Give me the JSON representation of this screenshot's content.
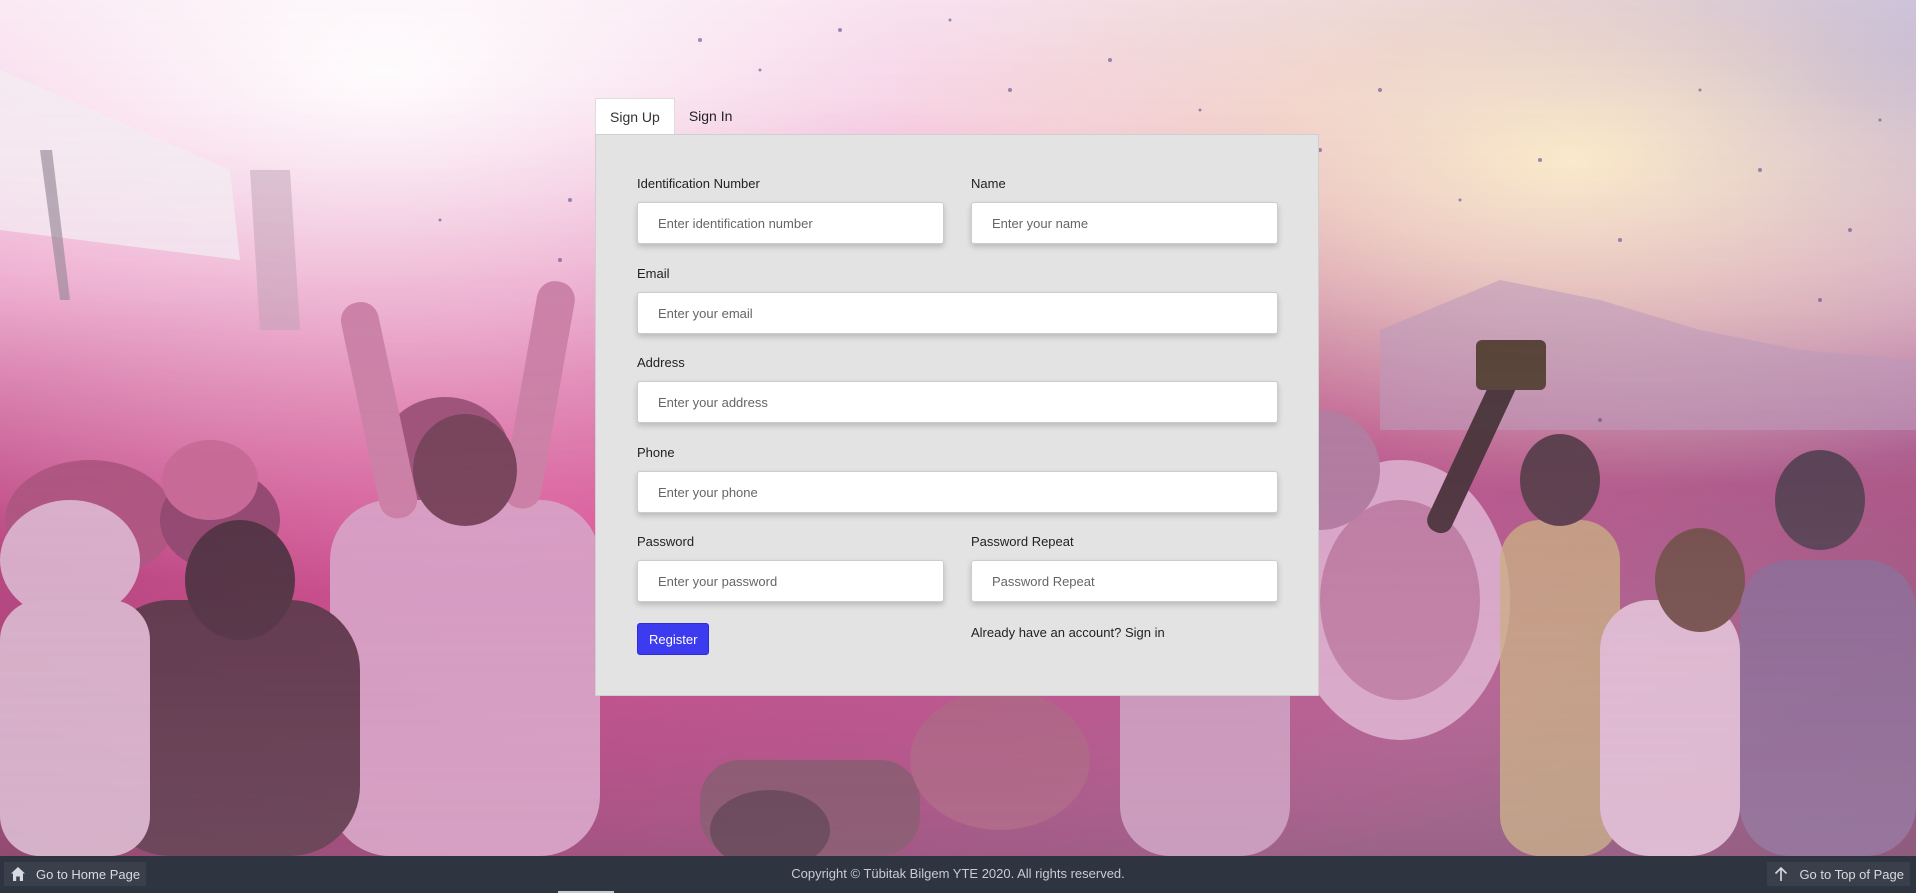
{
  "tabs": [
    {
      "label": "Sign Up",
      "active": true
    },
    {
      "label": "Sign In",
      "active": false
    }
  ],
  "form": {
    "id_number": {
      "label": "Identification Number",
      "placeholder": "Enter identification number",
      "value": ""
    },
    "name": {
      "label": "Name",
      "placeholder": "Enter your name",
      "value": ""
    },
    "email": {
      "label": "Email",
      "placeholder": "Enter your email",
      "value": ""
    },
    "address": {
      "label": "Address",
      "placeholder": "Enter your address",
      "value": ""
    },
    "phone": {
      "label": "Phone",
      "placeholder": "Enter your phone",
      "value": ""
    },
    "password": {
      "label": "Password",
      "placeholder": "Enter your password",
      "value": ""
    },
    "password_repeat": {
      "label": "Password Repeat",
      "placeholder": "Password Repeat",
      "value": ""
    },
    "register_label": "Register",
    "signin_prompt": "Already have an account?",
    "signin_link": "Sign in"
  },
  "footer": {
    "home_label": "Go to Home Page",
    "home_icon": "home-icon",
    "copyright": "Copyright © Tübitak Bilgem YTE 2020. All rights reserved.",
    "top_label": "Go to Top of Page",
    "top_icon": "arrow-up-icon"
  },
  "colors": {
    "accent_button": "#3d3bf0",
    "card_background": "#e3e3e3",
    "footer_background": "#2e3440"
  }
}
